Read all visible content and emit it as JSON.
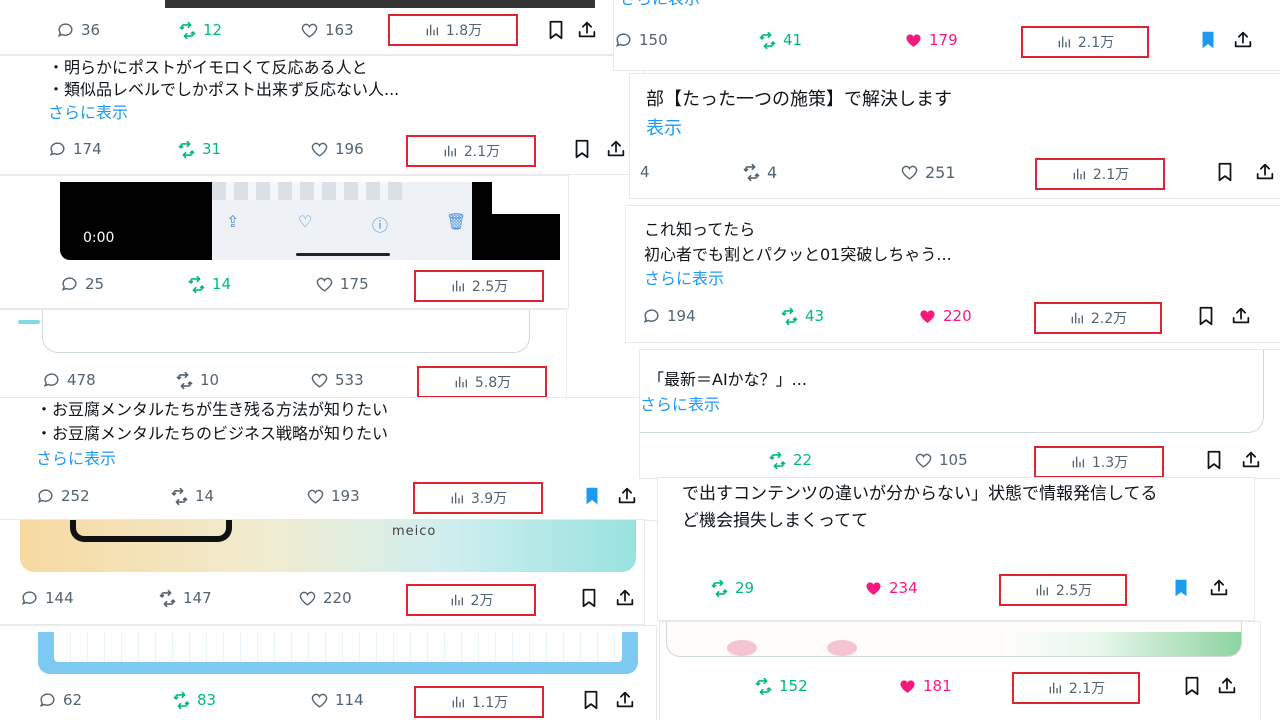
{
  "colors": {
    "accent": "#1d9bf0",
    "retweet": "#00ba7c",
    "like": "#f91880",
    "highlight_box": "#e0242f"
  },
  "left": [
    {
      "id": "L1",
      "reply": "36",
      "retweet": "12",
      "like": "163",
      "views": "1.8万",
      "liked": false,
      "bookmarked": false
    },
    {
      "id": "L2",
      "lines": [
        "・明らかにポストがイモロくて反応ある人と",
        "・類似品レベルでしかポスト出来ず反応ない人..."
      ],
      "more": "さらに表示",
      "reply": "174",
      "retweet": "31",
      "like": "196",
      "views": "2.1万",
      "liked": false,
      "bookmarked": false
    },
    {
      "id": "L3",
      "video_time": "0:00",
      "reply": "25",
      "retweet": "14",
      "like": "175",
      "views": "2.5万",
      "liked": false,
      "bookmarked": false
    },
    {
      "id": "L4",
      "reply": "478",
      "retweet": "10",
      "like": "533",
      "views": "5.8万",
      "liked": false,
      "bookmarked": false
    },
    {
      "id": "L5",
      "lines": [
        "・お豆腐メンタルたちが生き残る方法が知りたい",
        "・お豆腐メンタルたちのビジネス戦略が知りたい"
      ],
      "more": "さらに表示",
      "reply": "252",
      "retweet": "14",
      "like": "193",
      "views": "3.9万",
      "liked": false,
      "bookmarked": true
    },
    {
      "id": "L6",
      "image_text": "meico",
      "reply": "144",
      "retweet": "147",
      "like": "220",
      "views": "2万",
      "liked": false,
      "bookmarked": false
    },
    {
      "id": "L7",
      "reply": "62",
      "retweet": "83",
      "like": "114",
      "views": "1.1万",
      "liked": false,
      "bookmarked": false
    }
  ],
  "right": [
    {
      "id": "R1",
      "top_more": "さらに表示",
      "reply": "150",
      "retweet": "41",
      "like": "179",
      "views": "2.1万",
      "liked": true,
      "bookmarked": true
    },
    {
      "id": "R2",
      "lines": [
        "部【たった一つの施策】で解決します"
      ],
      "more": "表示",
      "reply": "4",
      "retweet": "4",
      "like": "251",
      "views": "2.1万",
      "liked": false,
      "bookmarked": false
    },
    {
      "id": "R3",
      "lines": [
        "これ知ってたら",
        "初心者でも割とパクッと01突破しちゃう..."
      ],
      "more": "さらに表示",
      "reply": "194",
      "retweet": "43",
      "like": "220",
      "views": "2.2万",
      "liked": true,
      "bookmarked": false
    },
    {
      "id": "R4",
      "lines": [
        "「最新＝AIかな？」..."
      ],
      "more": "さらに表示",
      "retweet": "22",
      "like": "105",
      "views": "1.3万",
      "liked": false,
      "bookmarked": false
    },
    {
      "id": "R5",
      "lines": [
        "で出すコンテンツの違いが分からない」状態で情報発信してる",
        "ど機会損失しまくってて"
      ],
      "retweet": "29",
      "like": "234",
      "views": "2.5万",
      "liked": true,
      "bookmarked": true
    },
    {
      "id": "R6",
      "retweet": "152",
      "like": "181",
      "views": "2.1万",
      "liked": true,
      "bookmarked": false
    }
  ]
}
